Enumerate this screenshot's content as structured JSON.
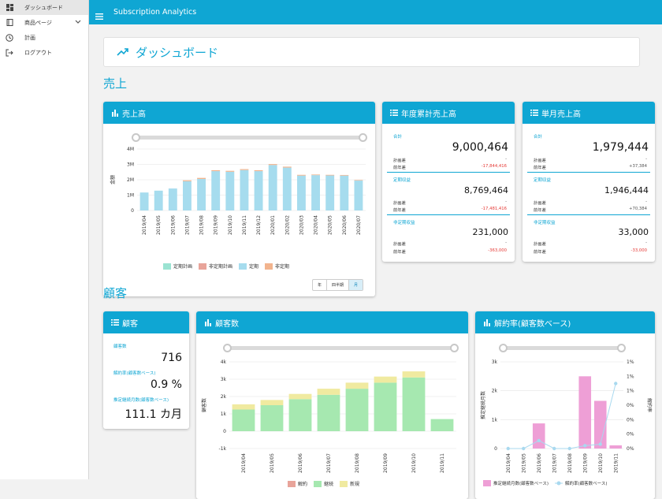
{
  "app": {
    "title": "Subscription Analytics"
  },
  "sidebar": {
    "items": [
      {
        "label": "ダッシュボード",
        "icon": "dashboard-icon"
      },
      {
        "label": "商品ページ",
        "icon": "book-icon"
      },
      {
        "label": "計画",
        "icon": "clock-icon"
      },
      {
        "label": "ログアウト",
        "icon": "logout-icon"
      }
    ]
  },
  "page": {
    "title": "ダッシュボード"
  },
  "sections": {
    "sales": "売上",
    "customers": "顧客"
  },
  "colors": {
    "accent": "#0fa6d3",
    "negative": "#e53935"
  },
  "sales_chart": {
    "title": "売上高",
    "ylabel": "金額",
    "toggle": [
      "年",
      "四半期",
      "月"
    ],
    "selected": "月"
  },
  "annual": {
    "title": "年度累計売上高",
    "total": {
      "label": "合計",
      "value": "9,000,464",
      "plan_label": "計画差",
      "plan": "-",
      "prev_label": "前年差",
      "prev": "-17,844,416"
    },
    "regular": {
      "label": "定期収益",
      "value": "8,769,464",
      "plan_label": "計画差",
      "plan": "-",
      "prev_label": "前年差",
      "prev": "-17,481,416"
    },
    "irregular": {
      "label": "非定期収益",
      "value": "231,000",
      "plan_label": "計画差",
      "plan": "-",
      "prev_label": "前年差",
      "prev": "-363,000"
    }
  },
  "monthly": {
    "title": "単月売上高",
    "total": {
      "label": "合計",
      "value": "1,979,444",
      "plan_label": "計画差",
      "plan": "-",
      "prev_label": "前年差",
      "prev": "+37,384"
    },
    "regular": {
      "label": "定期収益",
      "value": "1,946,444",
      "plan_label": "計画差",
      "plan": "-",
      "prev_label": "前年差",
      "prev": "+70,384"
    },
    "irregular": {
      "label": "非定期収益",
      "value": "33,000",
      "plan_label": "計画差",
      "plan": "-",
      "prev_label": "前年差",
      "prev": "-33,000"
    }
  },
  "customer_card": {
    "title": "顧客",
    "count_label": "顧客数",
    "count": "716",
    "churn_label": "解約率(顧客数ベース)",
    "churn": "0.9 %",
    "tenure_label": "推定継続月数(顧客数ベース)",
    "tenure": "111.1 カ月"
  },
  "customer_chart": {
    "title": "顧客数",
    "ylabel": "顧客数"
  },
  "churn_chart": {
    "title": "解約率(顧客数ベース)",
    "ylabel_left": "推定継続月数",
    "ylabel_right": "解約率"
  },
  "chart_data": [
    {
      "type": "bar",
      "title": "売上高",
      "xlabel": "",
      "ylabel": "金額",
      "ylim": [
        0,
        4000000
      ],
      "yticks": [
        "0",
        "1M",
        "2M",
        "3M",
        "4M"
      ],
      "categories": [
        "2019/04",
        "2019/05",
        "2019/06",
        "2019/07",
        "2019/08",
        "2019/09",
        "2019/10",
        "2019/11",
        "2019/12",
        "2020/01",
        "2020/02",
        "2020/03",
        "2020/04",
        "2020/05",
        "2020/06",
        "2020/07"
      ],
      "series": [
        {
          "name": "定期計画",
          "color": "#9be3d2",
          "values": [
            0,
            0,
            0,
            0,
            0,
            0,
            0,
            0,
            0,
            0,
            0,
            0,
            0,
            0,
            0,
            0
          ]
        },
        {
          "name": "非定期計画",
          "color": "#e8a49a",
          "values": [
            0,
            0,
            0,
            0,
            0,
            0,
            0,
            0,
            0,
            0,
            0,
            0,
            0,
            0,
            0,
            0
          ]
        },
        {
          "name": "定期",
          "color": "#a6dcee",
          "values": [
            1170000,
            1290000,
            1430000,
            1900000,
            2050000,
            2560000,
            2520000,
            2630000,
            2560000,
            2960000,
            2790000,
            2270000,
            2300000,
            2280000,
            2270000,
            1946444
          ]
        },
        {
          "name": "非定期",
          "color": "#f2b48e",
          "values": [
            0,
            0,
            0,
            60000,
            70000,
            60000,
            60000,
            60000,
            60000,
            60000,
            60000,
            50000,
            40000,
            40000,
            40000,
            33000
          ]
        }
      ],
      "grid": true,
      "legend": "bottom"
    },
    {
      "type": "bar",
      "title": "顧客数",
      "ylabel": "顧客数",
      "ylim": [
        -1000,
        4000
      ],
      "yticks": [
        "-1k",
        "0",
        "1k",
        "2k",
        "3k",
        "4k"
      ],
      "categories": [
        "2019/04",
        "2019/05",
        "2019/06",
        "2019/07",
        "2019/08",
        "2019/09",
        "2019/10",
        "2019/11"
      ],
      "series": [
        {
          "name": "解約",
          "color": "#e8a49a",
          "values": [
            0,
            0,
            0,
            0,
            0,
            0,
            0,
            0
          ]
        },
        {
          "name": "継続",
          "color": "#a6e8b0",
          "values": [
            1250,
            1500,
            1850,
            2100,
            2450,
            2800,
            3100,
            700
          ]
        },
        {
          "name": "新規",
          "color": "#f0eaa0",
          "values": [
            300,
            300,
            300,
            350,
            350,
            350,
            350,
            0
          ]
        }
      ],
      "grid": true,
      "legend": "bottom"
    },
    {
      "type": "bar",
      "title": "解約率(顧客数ベース)",
      "ylabel": "推定継続月数",
      "y2label": "解約率",
      "ylim": [
        0,
        3000
      ],
      "yticks": [
        "0",
        "1k",
        "2k",
        "3k"
      ],
      "y2lim": [
        0,
        1.2
      ],
      "y2ticks": [
        "0%",
        "0%",
        "0%",
        "0%",
        "1%",
        "1%",
        "1%"
      ],
      "categories": [
        "2019/04",
        "2019/05",
        "2019/06",
        "2019/07",
        "2019/08",
        "2019/09",
        "2019/10",
        "2019/11"
      ],
      "series": [
        {
          "name": "推定継続月数(顧客数ベース)",
          "type": "bar",
          "color": "#ee9fd6",
          "values": [
            0,
            0,
            870,
            0,
            0,
            2500,
            1650,
            111
          ]
        },
        {
          "name": "解約率(顧客数ベース)",
          "type": "line",
          "color": "#a9d9ef",
          "values": [
            0,
            0,
            0.11,
            0,
            0,
            0.04,
            0.06,
            0.9
          ]
        }
      ],
      "grid": true,
      "legend": "bottom"
    }
  ]
}
